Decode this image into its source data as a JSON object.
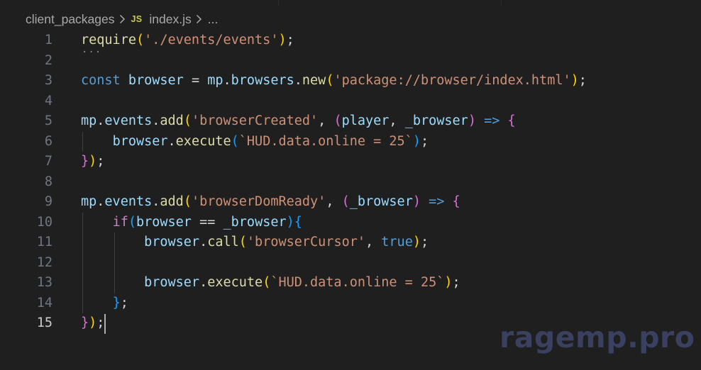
{
  "breadcrumb": {
    "folder": "client_packages",
    "file_icon": "JS",
    "file": "index.js",
    "more": "..."
  },
  "editor": {
    "active_line": 15,
    "lines": [
      {
        "no": "1",
        "tokens": [
          [
            "c-fn",
            "require"
          ],
          [
            "c-b1",
            "("
          ],
          [
            "c-str",
            "'./events/events'"
          ],
          [
            "c-b1",
            ")"
          ],
          [
            "c-pl",
            ";"
          ]
        ]
      },
      {
        "no": "2",
        "tokens": []
      },
      {
        "no": "3",
        "tokens": [
          [
            "c-kw",
            "const"
          ],
          [
            "c-pl",
            " "
          ],
          [
            "c-var",
            "browser"
          ],
          [
            "c-pl",
            " = "
          ],
          [
            "c-var",
            "mp"
          ],
          [
            "c-pl",
            "."
          ],
          [
            "c-var",
            "browsers"
          ],
          [
            "c-pl",
            "."
          ],
          [
            "c-fn",
            "new"
          ],
          [
            "c-b1",
            "("
          ],
          [
            "c-str",
            "'package://browser/index.html'"
          ],
          [
            "c-b1",
            ")"
          ],
          [
            "c-pl",
            ";"
          ]
        ]
      },
      {
        "no": "4",
        "tokens": []
      },
      {
        "no": "5",
        "tokens": [
          [
            "c-var",
            "mp"
          ],
          [
            "c-pl",
            "."
          ],
          [
            "c-var",
            "events"
          ],
          [
            "c-pl",
            "."
          ],
          [
            "c-fn",
            "add"
          ],
          [
            "c-b1",
            "("
          ],
          [
            "c-str",
            "'browserCreated'"
          ],
          [
            "c-pl",
            ", "
          ],
          [
            "c-b2",
            "("
          ],
          [
            "c-var",
            "player"
          ],
          [
            "c-pl",
            ", "
          ],
          [
            "c-var",
            "_browser"
          ],
          [
            "c-b2",
            ")"
          ],
          [
            "c-pl",
            " "
          ],
          [
            "c-kw",
            "=>"
          ],
          [
            "c-pl",
            " "
          ],
          [
            "c-b2",
            "{"
          ]
        ]
      },
      {
        "no": "6",
        "tokens": [
          [
            "c-pl",
            "    "
          ],
          [
            "c-var",
            "browser"
          ],
          [
            "c-pl",
            "."
          ],
          [
            "c-fn",
            "execute"
          ],
          [
            "c-b3",
            "("
          ],
          [
            "c-str",
            "`HUD.data.online = 25`"
          ],
          [
            "c-b3",
            ")"
          ],
          [
            "c-pl",
            ";"
          ]
        ]
      },
      {
        "no": "7",
        "tokens": [
          [
            "c-b2",
            "}"
          ],
          [
            "c-b1",
            ")"
          ],
          [
            "c-pl",
            ";"
          ]
        ]
      },
      {
        "no": "8",
        "tokens": []
      },
      {
        "no": "9",
        "tokens": [
          [
            "c-var",
            "mp"
          ],
          [
            "c-pl",
            "."
          ],
          [
            "c-var",
            "events"
          ],
          [
            "c-pl",
            "."
          ],
          [
            "c-fn",
            "add"
          ],
          [
            "c-b1",
            "("
          ],
          [
            "c-str",
            "'browserDomReady'"
          ],
          [
            "c-pl",
            ", "
          ],
          [
            "c-b2",
            "("
          ],
          [
            "c-var",
            "_browser"
          ],
          [
            "c-b2",
            ")"
          ],
          [
            "c-pl",
            " "
          ],
          [
            "c-kw",
            "=>"
          ],
          [
            "c-pl",
            " "
          ],
          [
            "c-b2",
            "{"
          ]
        ]
      },
      {
        "no": "10",
        "tokens": [
          [
            "c-pl",
            "    "
          ],
          [
            "c-ctl",
            "if"
          ],
          [
            "c-b3",
            "("
          ],
          [
            "c-var",
            "browser"
          ],
          [
            "c-pl",
            " == "
          ],
          [
            "c-var",
            "_browser"
          ],
          [
            "c-b3",
            ")"
          ],
          [
            "c-b3",
            "{"
          ]
        ]
      },
      {
        "no": "11",
        "tokens": [
          [
            "c-pl",
            "        "
          ],
          [
            "c-var",
            "browser"
          ],
          [
            "c-pl",
            "."
          ],
          [
            "c-fn",
            "call"
          ],
          [
            "c-b1",
            "("
          ],
          [
            "c-str",
            "'browserCursor'"
          ],
          [
            "c-pl",
            ", "
          ],
          [
            "c-kw",
            "true"
          ],
          [
            "c-b1",
            ")"
          ],
          [
            "c-pl",
            ";"
          ]
        ]
      },
      {
        "no": "12",
        "tokens": []
      },
      {
        "no": "13",
        "tokens": [
          [
            "c-pl",
            "        "
          ],
          [
            "c-var",
            "browser"
          ],
          [
            "c-pl",
            "."
          ],
          [
            "c-fn",
            "execute"
          ],
          [
            "c-b1",
            "("
          ],
          [
            "c-str",
            "`HUD.data.online = 25`"
          ],
          [
            "c-b1",
            ")"
          ],
          [
            "c-pl",
            ";"
          ]
        ]
      },
      {
        "no": "14",
        "tokens": [
          [
            "c-pl",
            "    "
          ],
          [
            "c-b3",
            "}"
          ],
          [
            "c-pl",
            ";"
          ]
        ]
      },
      {
        "no": "15",
        "tokens": [
          [
            "c-b2",
            "}"
          ],
          [
            "c-b1",
            ")"
          ],
          [
            "c-pl",
            ";"
          ]
        ]
      }
    ]
  },
  "watermark": "ragemp.pro",
  "colors": {
    "background": "#1f1f1f",
    "function": "#dcdcaa",
    "string": "#ce9178",
    "keyword": "#569cd6",
    "variable": "#9cdcfe",
    "control": "#c586c0",
    "bracket_gold": "#ffd700",
    "bracket_orchid": "#da70d6",
    "bracket_blue": "#179fff"
  }
}
